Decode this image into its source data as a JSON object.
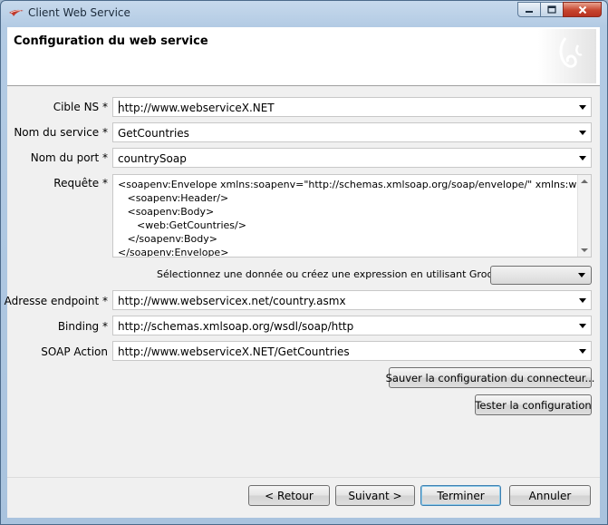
{
  "window": {
    "title": "Client Web Service"
  },
  "header": {
    "title": "Configuration du web service"
  },
  "form": {
    "cible_ns": {
      "label": "Cible NS *",
      "value": "http://www.webserviceX.NET"
    },
    "nom_service": {
      "label": "Nom du service *",
      "value": "GetCountries"
    },
    "nom_port": {
      "label": "Nom du port *",
      "value": "countrySoap"
    },
    "requete": {
      "label": "Requête *",
      "value": "<soapenv:Envelope xmlns:soapenv=\"http://schemas.xmlsoap.org/soap/envelope/\" xmlns:web=\"http://www.webserviceX.NET\">\n   <soapenv:Header/>\n   <soapenv:Body>\n      <web:GetCountries/>\n   </soapenv:Body>\n</soapenv:Envelope>"
    },
    "groovy": {
      "label": "Sélectionnez une donnée ou créez une expression en utilisant Groovy",
      "value": ""
    },
    "endpoint": {
      "label": "Adresse endpoint *",
      "value": "http://www.webservicex.net/country.asmx"
    },
    "binding": {
      "label": "Binding *",
      "value": "http://schemas.xmlsoap.org/wsdl/soap/http"
    },
    "soap_action": {
      "label": "SOAP Action",
      "value": "http://www.webserviceX.NET/GetCountries"
    }
  },
  "actions": {
    "save_config": "Sauver la configuration du connecteur...",
    "test_config": "Tester la configuration"
  },
  "footer": {
    "back": "< Retour",
    "next": "Suivant >",
    "finish": "Terminer",
    "cancel": "Annuler"
  },
  "icons": {
    "app": "app-icon",
    "logo": "bonita-logo-icon",
    "minimize": "minimize-icon",
    "maximize": "maximize-icon",
    "close": "close-icon",
    "dropdown": "chevron-down-icon"
  },
  "colors": {
    "titlebar": "#b3cbe4",
    "close_button": "#c6462f",
    "default_button_border": "#3c7fb1"
  }
}
